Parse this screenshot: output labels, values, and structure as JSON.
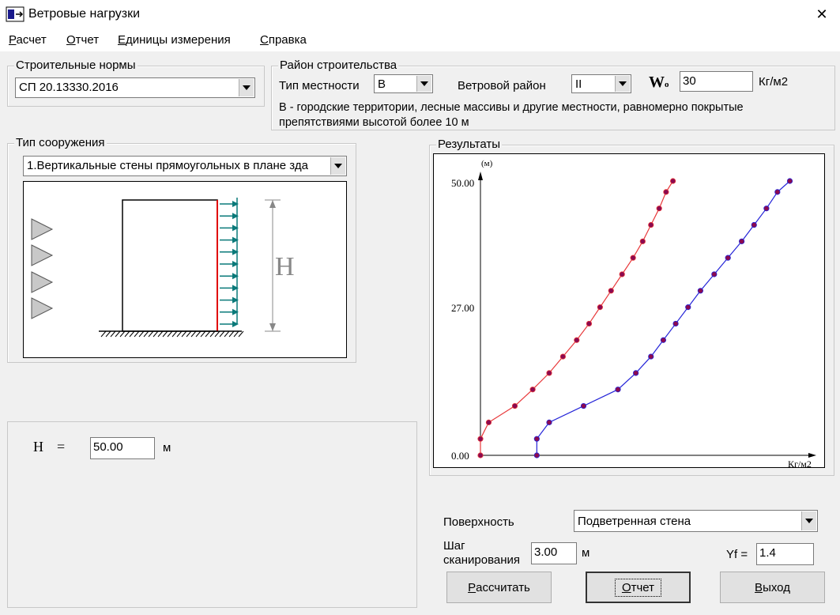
{
  "window": {
    "title": "Ветровые нагрузки",
    "close_glyph": "✕"
  },
  "menu": [
    {
      "first": "Р",
      "rest": "асчет"
    },
    {
      "first": "О",
      "rest": "тчет"
    },
    {
      "first": "Е",
      "rest": "диницы измерения"
    },
    {
      "first": "С",
      "rest": "правка"
    }
  ],
  "norms": {
    "legend": "Строительные нормы",
    "selected": "СП 20.13330.2016"
  },
  "district": {
    "legend": "Район строительства",
    "terrain_label": "Тип местности",
    "terrain_value": "B",
    "wind_label": "Ветровой район",
    "wind_value": "II",
    "w0_label_main": "W",
    "w0_label_sub": "o",
    "w0_value": "30",
    "w0_unit": "Кг/м2",
    "description_line1": "B - городские территории, лесные массивы и другие  местности, равномерно покрытые",
    "description_line2": "препятствиями высотой более 10 м"
  },
  "structure": {
    "legend": "Тип сооружения",
    "selected": "1.Вертикальные стены прямоугольных в плане зда",
    "diagram_height_label": "H"
  },
  "height": {
    "label": "H",
    "eq": "=",
    "value": "50.00",
    "unit": "м"
  },
  "results": {
    "legend": "Результаты",
    "y_unit": "(м)",
    "x_unit": "Кг/м2",
    "y_ticks": [
      "50.00",
      "27.00",
      "0.00"
    ]
  },
  "chart_data": {
    "type": "line",
    "ylabel": "(м)",
    "xlabel": "Кг/м2",
    "ylim": [
      0,
      50
    ],
    "y_ticks": [
      0,
      27,
      50
    ],
    "series": [
      {
        "color": "#e8383a",
        "x": [
          0.0,
          0.0,
          0.6,
          2.5,
          3.8,
          5.0,
          6.0,
          7.0,
          7.9,
          8.7,
          9.5,
          10.3,
          11.1,
          11.8,
          12.4,
          13.0,
          13.5,
          14.0
        ],
        "y": [
          0,
          3,
          6,
          9,
          12,
          15,
          18,
          21,
          24,
          27,
          30,
          33,
          36,
          39,
          42,
          45,
          48,
          50
        ]
      },
      {
        "color": "#2424d8",
        "x": [
          4.1,
          4.1,
          5.0,
          7.5,
          10.0,
          11.3,
          12.4,
          13.3,
          14.2,
          15.1,
          16.0,
          17.0,
          18.0,
          19.0,
          19.9,
          20.8,
          21.6,
          22.5
        ],
        "y": [
          0,
          3,
          6,
          9,
          12,
          15,
          18,
          21,
          24,
          27,
          30,
          33,
          36,
          39,
          42,
          45,
          48,
          50
        ]
      }
    ],
    "marker_color": "#8b0a50"
  },
  "surface": {
    "label": "Поверхность",
    "selected": "Подветренная стена"
  },
  "scan": {
    "label1": "Шаг",
    "label2": "сканирования",
    "value": "3.00",
    "unit": "м"
  },
  "yf": {
    "label": "Yf =",
    "value": "1.4"
  },
  "buttons": {
    "calc_first": "Р",
    "calc_rest": "ассчитать",
    "report_first": "О",
    "report_rest": "тчет",
    "exit_first": "В",
    "exit_rest": "ыход"
  }
}
